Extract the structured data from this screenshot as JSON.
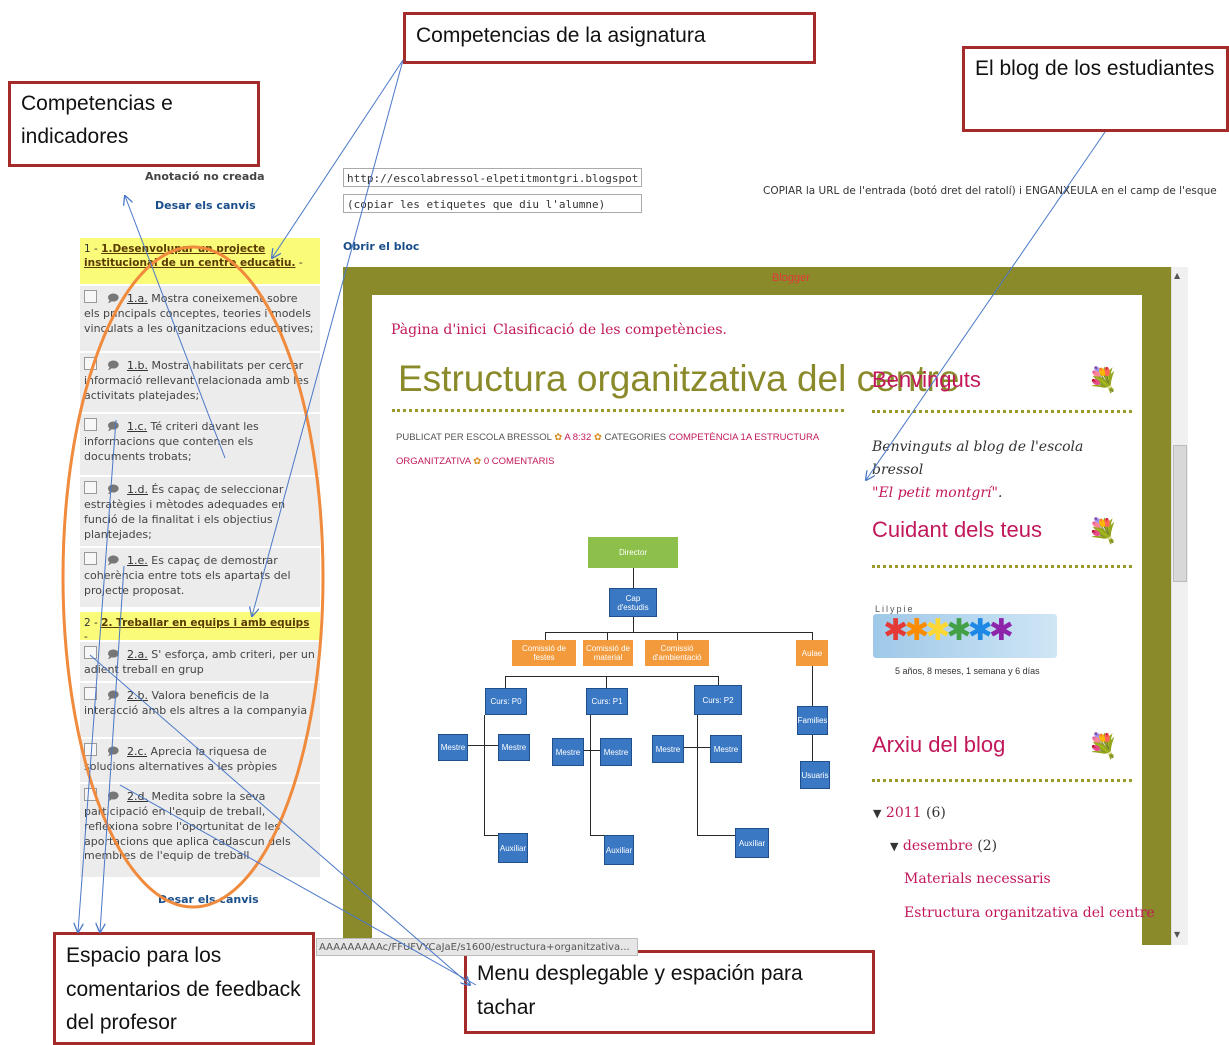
{
  "callouts": {
    "competencias_asignatura": "Competencias de la asignatura",
    "competencias_indicadores": "Competencias e indicadores",
    "blog_estudiantes": "El blog de los estudiantes",
    "espacio_comentarios": "Espacio para los comentarios de feedback del profesor",
    "menu_desplegable": "Menu desplegable y espación para tachar"
  },
  "left_panel": {
    "annotation_status": "Anotació no creada",
    "save_top": "Desar els canvis",
    "save_bottom": "Desar els canvis",
    "competences": [
      {
        "prefix": "1 - ",
        "title": "1.Desenvolupar un projecte institucional de un centre educatiu.",
        "suffix": " -",
        "indicators": [
          {
            "code": "1.a.",
            "text": " Mostra coneixement sobre els principals conceptes, teories i models vinculats a les organitzacions educatives;"
          },
          {
            "code": "1.b.",
            "text": " Mostra habilitats per cercar informació rellevant relacionada amb les activitats platejades;"
          },
          {
            "code": "1.c.",
            "text": " Té criteri davant les informacions que contenen els documents trobats;"
          },
          {
            "code": "1.d.",
            "text": " És capaç de seleccionar estratègies i mètodes adequades en funció de la finalitat i els objectius plantejades;"
          },
          {
            "code": "1.e.",
            "text": " Es capaç de demostrar coherència entre tots els apartats del projecte proposat."
          }
        ]
      },
      {
        "prefix": "2 - ",
        "title": "2. Treballar en equips i amb equips",
        "suffix": " -",
        "indicators": [
          {
            "code": "2.a.",
            "text": " S' esforça, amb criteri, per un adient treball en grup"
          },
          {
            "code": "2.b.",
            "text": " Valora beneficis de la interacció amb els altres a la companyia"
          },
          {
            "code": "2.c.",
            "text": " Aprecia la riquesa de solucions alternatives a les pròpies"
          },
          {
            "code": "2.d.",
            "text": " Medita sobre la seva participació en l'equip de treball, reflexiona sobre l'oportunitat de les aportacions que aplica cadascun dels membres de l'equip de treball"
          }
        ]
      }
    ]
  },
  "top": {
    "url_value": "http://escolabressol-elpetitmontgri.blogspot.com/",
    "tags_value": "(copiar les etiquetes que diu l'alumne)",
    "open_blog": "Obrir el bloc",
    "instruction": "COPIAR la URL de l'entrada (botó dret del ratolí) i ENGANXEULA en el camp de l'esque"
  },
  "status_url": "AAAAAAAAAc/FFUFVYCaJaE/s1600/estructura+organitzativa...",
  "blog": {
    "blogger_label": "Blogger",
    "nav": [
      "Pàgina d'inici",
      "Clasificació de les competències."
    ],
    "post_title": "Estructura organitzativa del centre",
    "meta_1a": "PUBLICAT PER ESCOLA BRESSOL",
    "meta_1b": "A 8:32",
    "meta_1c": "CATEGORIES",
    "meta_1d": "COMPETÈNCIA 1A ESTRUCTURA",
    "meta_2a": "ORGANITZATIVA",
    "meta_2b": "0 COMENTARIS",
    "org_chart": {
      "director": "Director",
      "cap": "Cap d'estudis",
      "comissions": [
        "Comissió de festes",
        "Comissió de material",
        "Comissió d'ambientació"
      ],
      "aulae": "Aulae",
      "cursos": [
        "Curs: P0",
        "Curs: P1",
        "Curs: P2"
      ],
      "mestre": "Mestre",
      "auxiliar": "Auxiliar",
      "families": "Families",
      "usuaris": "Usuaris"
    },
    "sidebar": {
      "welcome_title": "Benvinguts",
      "welcome_text": "Benvinguts al blog de l'escola bressol",
      "welcome_link": "\"El petit montgrí\"",
      "welcome_end": ".",
      "cuidant_title": "Cuidant dels teus",
      "lilypie_label": "Lilypie",
      "age_text": "5 años, 8 meses, 1 semana y 6 días",
      "archive_title": "Arxiu del blog",
      "year": "2011",
      "year_count": " (6)",
      "month": "desembre",
      "month_count": " (2)",
      "posts": [
        "Materials necessaris",
        "Estructura organitzativa del centre"
      ]
    }
  },
  "colors": {
    "callout_border": "#a52a2a",
    "ellipse": "#f08a3c",
    "arrow": "#4a78c8",
    "blog_frame": "#8b8a2a",
    "pink": "#c2185b",
    "highlight": "#fbfb7a"
  }
}
